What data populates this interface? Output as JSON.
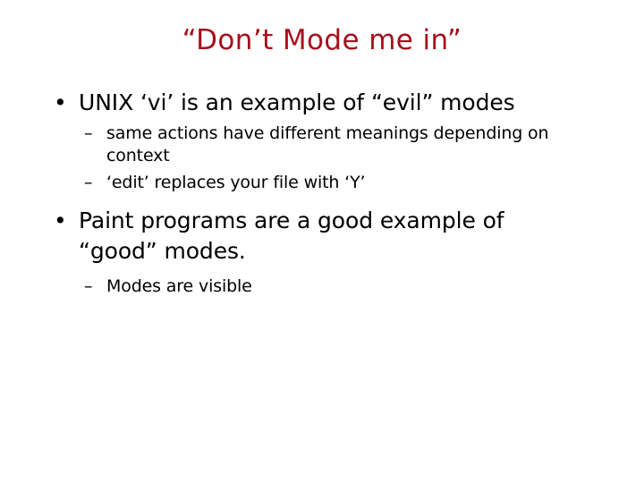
{
  "slide": {
    "title": "“Don’t Mode me in”",
    "title_color": "#a5101c",
    "body_color": "#000000",
    "background_color": "#ffffff",
    "bullet_marker_level1": "•",
    "bullet_marker_level2": "–",
    "content": [
      {
        "level": 1,
        "marker": "•",
        "text": "UNIX ‘vi’ is an example of “evil” modes"
      },
      {
        "level": 2,
        "marker": "–",
        "text": "same actions have different meanings depending on context"
      },
      {
        "level": 2,
        "marker": "–",
        "text": "‘edit’ replaces your file with ‘Y’"
      },
      {
        "level": 1,
        "marker": "•",
        "text": "Paint programs are a good example of “good” modes."
      },
      {
        "level": 2,
        "marker": "–",
        "text": "Modes are visible"
      }
    ]
  }
}
